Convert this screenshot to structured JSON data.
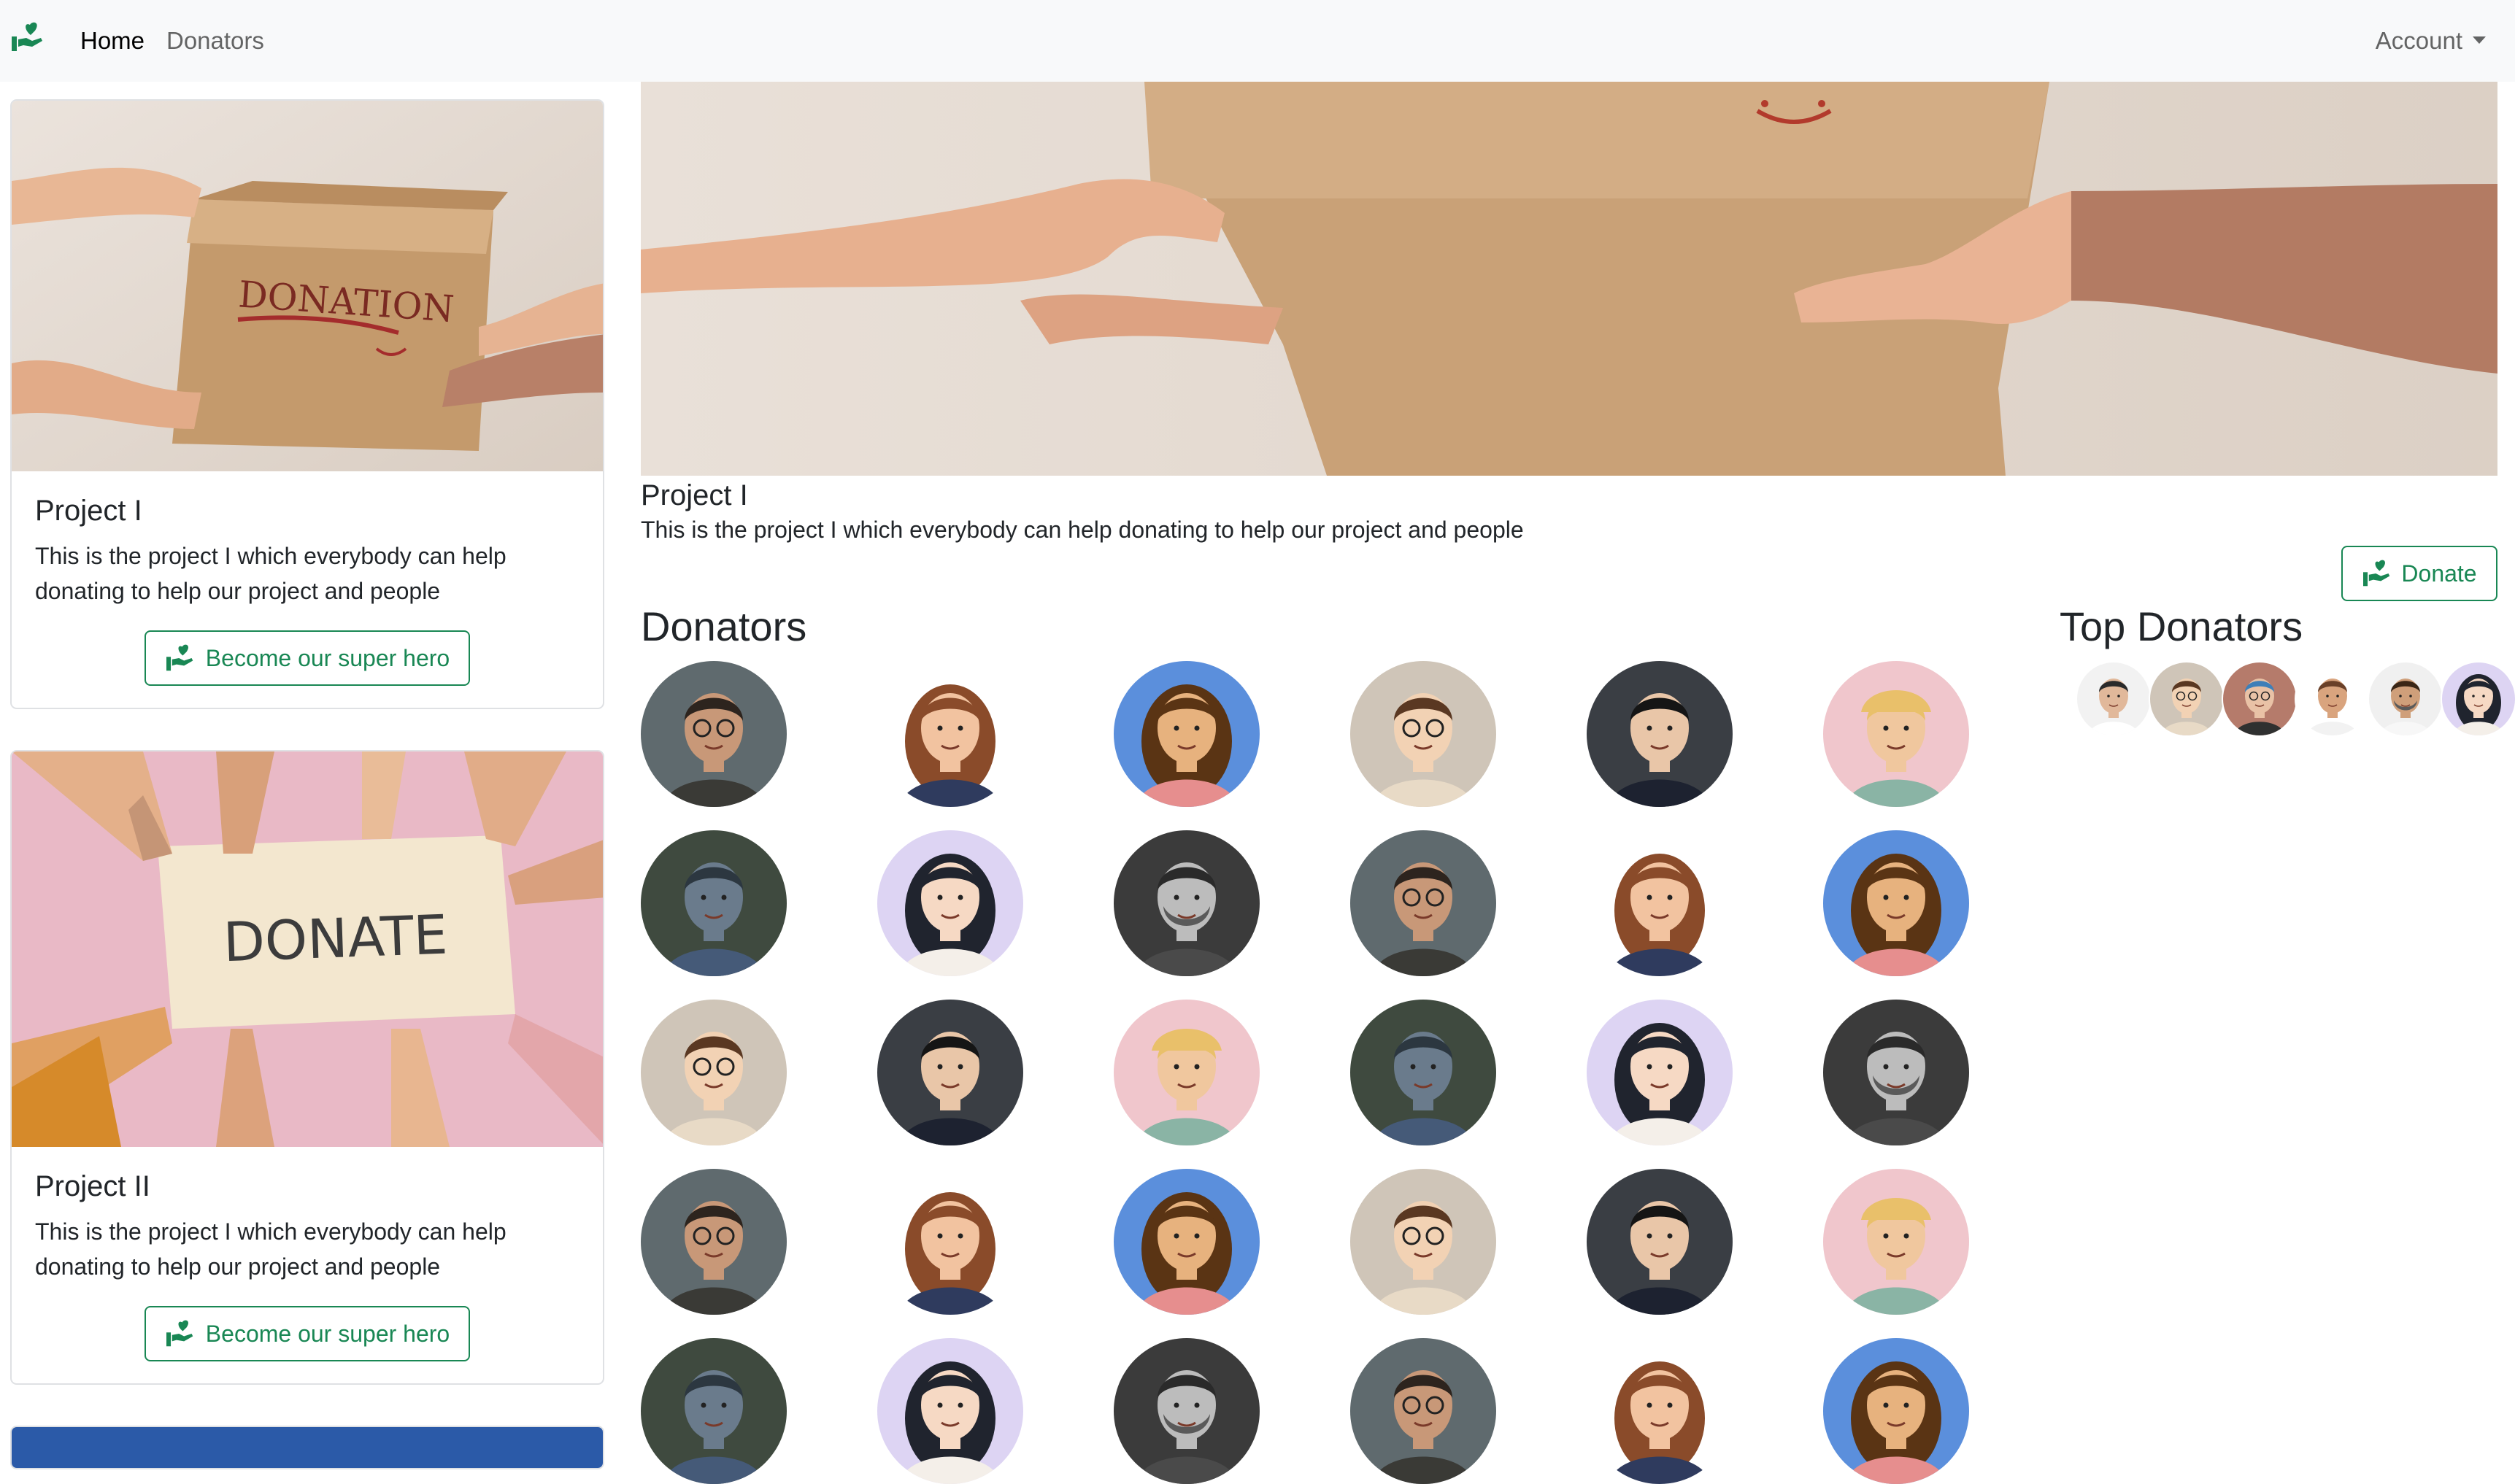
{
  "navbar": {
    "brand_icon": "donate-hand-heart-icon",
    "home_label": "Home",
    "donators_label": "Donators",
    "account_label": "Account"
  },
  "projects": [
    {
      "title": "Project I",
      "description": "This is the project I which everybody can help donating to help our project and people",
      "button_label": "Become our super hero",
      "image": "donation-box-photo",
      "box_text": "DONATION"
    },
    {
      "title": "Project II",
      "description": "This is the project I which everybody can help donating to help our project and people",
      "button_label": "Become our super hero",
      "image": "donate-sign-photo",
      "sign_text": "DONATE"
    }
  ],
  "main": {
    "project_title": "Project I",
    "project_description": "This is the project I which everybody can help donating to help our project and people",
    "donate_label": "Donate",
    "donators_heading": "Donators",
    "top_donators_heading": "Top Donators"
  },
  "colors": {
    "accent_green": "#198754",
    "navbar_bg": "#f8f9fa"
  },
  "avatar_styles": [
    "man-glasses-photo",
    "cartoon-woman-suit",
    "woman-sky-portrait",
    "cartoon-man-glasses-beige",
    "man-dark-suit",
    "man-pink-hat",
    "man-crouching-photo",
    "girl-purple-stars",
    "man-bw-beard"
  ],
  "donator_grid": [
    0,
    1,
    2,
    3,
    4,
    5,
    6,
    7,
    8,
    0,
    1,
    2,
    3,
    4,
    5,
    6,
    7,
    8,
    0,
    1,
    2,
    3,
    4,
    5,
    6,
    7,
    8,
    0,
    1,
    2
  ],
  "top_donators": [
    "man-white-shirt",
    "cartoon-man-glasses",
    "blue-hair-person",
    "man-casual",
    "man-smiling",
    "girl-purple"
  ]
}
